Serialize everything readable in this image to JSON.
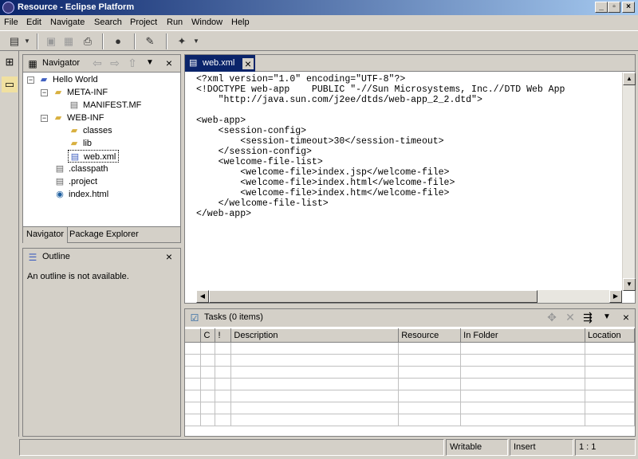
{
  "window": {
    "title": "Resource - Eclipse Platform"
  },
  "menu": [
    {
      "label": "File"
    },
    {
      "label": "Edit"
    },
    {
      "label": "Navigate"
    },
    {
      "label": "Search"
    },
    {
      "label": "Project"
    },
    {
      "label": "Run"
    },
    {
      "label": "Window"
    },
    {
      "label": "Help"
    }
  ],
  "navigator": {
    "title": "Navigator",
    "tree": [
      {
        "label": "Hello World",
        "icon": "project-icon"
      },
      {
        "label": "META-INF",
        "icon": "folder-icon"
      },
      {
        "label": "MANIFEST.MF",
        "icon": "file-icon"
      },
      {
        "label": "WEB-INF",
        "icon": "folder-icon"
      },
      {
        "label": "classes",
        "icon": "folder-icon"
      },
      {
        "label": "lib",
        "icon": "folder-icon"
      },
      {
        "label": "web.xml",
        "icon": "xml-file-icon"
      },
      {
        "label": ".classpath",
        "icon": "file-icon"
      },
      {
        "label": ".project",
        "icon": "file-icon"
      },
      {
        "label": "index.html",
        "icon": "html-file-icon"
      }
    ],
    "tabs": [
      {
        "label": "Navigator"
      },
      {
        "label": "Package Explorer"
      }
    ]
  },
  "outline": {
    "title": "Outline",
    "message": "An outline is not available."
  },
  "editor": {
    "tab_label": "web.xml",
    "content": "<?xml version=\"1.0\" encoding=\"UTF-8\"?>\n<!DOCTYPE web-app    PUBLIC \"-//Sun Microsystems, Inc.//DTD Web App\n    \"http://java.sun.com/j2ee/dtds/web-app_2_2.dtd\">\n\n<web-app>\n    <session-config>\n        <session-timeout>30</session-timeout>\n    </session-config>\n    <welcome-file-list>\n        <welcome-file>index.jsp</welcome-file>\n        <welcome-file>index.html</welcome-file>\n        <welcome-file>index.htm</welcome-file>\n    </welcome-file-list>\n</web-app>"
  },
  "tasks": {
    "title": "Tasks (0 items)",
    "columns": [
      {
        "label": ""
      },
      {
        "label": "C"
      },
      {
        "label": "!"
      },
      {
        "label": "Description"
      },
      {
        "label": "Resource"
      },
      {
        "label": "In Folder"
      },
      {
        "label": "Location"
      }
    ]
  },
  "status": {
    "mode": "Writable",
    "insert": "Insert",
    "position": "1 : 1"
  }
}
